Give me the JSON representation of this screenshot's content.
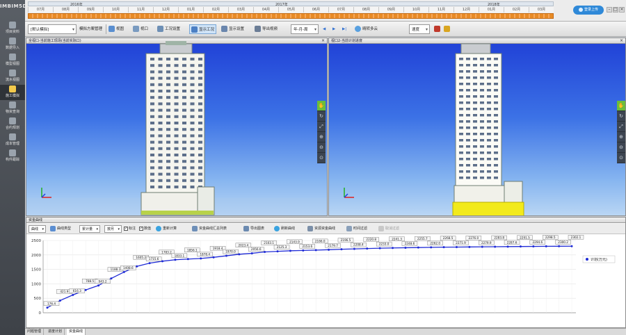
{
  "app": {
    "logo": "IMBIM5D"
  },
  "sidebar": {
    "items": [
      {
        "label": "项目资料",
        "active": false
      },
      {
        "label": "数据导入",
        "active": false
      },
      {
        "label": "模型视图",
        "active": false
      },
      {
        "label": "流水视图",
        "active": false
      },
      {
        "label": "施工模拟",
        "active": true
      },
      {
        "label": "物资查询",
        "active": false
      },
      {
        "label": "合约规划",
        "active": false
      },
      {
        "label": "成本管理",
        "active": false
      },
      {
        "label": "构件跟踪",
        "active": false
      }
    ]
  },
  "timeline": {
    "years": [
      "2016年",
      "2017年",
      "2018年"
    ],
    "months": [
      "07月",
      "08月",
      "09月",
      "10月",
      "11月",
      "12月",
      "01月",
      "02月",
      "03月",
      "04月",
      "05月",
      "06月",
      "07月",
      "08月",
      "09月",
      "10月",
      "11月",
      "12月",
      "01月",
      "02月",
      "03月"
    ],
    "online_button": "登录上传",
    "win_min": "–",
    "win_max": "□",
    "win_close": "×"
  },
  "toolbar": {
    "view_select": "[默认模拟]",
    "sim_manage": "模拟方案管理",
    "view": "视图",
    "viewport": "视口",
    "work_settings": "工况设置",
    "show_work": "显示工况",
    "display_settings": "显示设置",
    "export_video": "导出视频",
    "play_mode": "年-月-周",
    "play_prev": "◀",
    "play": "▶",
    "play_next": "▶|",
    "weather": "晴转多云",
    "speed": "速度"
  },
  "view_left": {
    "title": "全视口-当前施工现场(当前实际口)",
    "axis_x": "X",
    "axis_y": "Y"
  },
  "view_right": {
    "title": "视口2-当前计划进度",
    "axis_x": "X",
    "axis_y": "Y"
  },
  "view_tools": [
    "✋",
    "↻",
    "⤢",
    "⊕",
    "⊖",
    "⊙"
  ],
  "chart_panel": {
    "title": "资金曲线",
    "toolbar": {
      "curve_select": "曲线",
      "curve_type": "曲线类型",
      "amount_select": "累计量",
      "by_month_select": "按月",
      "chk_label": "标注",
      "chk_value": "数值",
      "recalc": "重新计算",
      "summary_list": "资金曲线汇总列表",
      "export_chart": "导出图表",
      "refresh": "刷新曲线",
      "capital_plan": "资源资金曲线",
      "time_filter": "时间过滤",
      "cancel_filter": "取消过滤"
    }
  },
  "chart_data": {
    "type": "line",
    "title": "",
    "xlabel": "",
    "ylabel": "",
    "ylim": [
      0,
      2500
    ],
    "yticks": [
      0,
      500,
      1000,
      1500,
      2000,
      2500
    ],
    "grid": true,
    "legend": "top-right",
    "series": [
      {
        "name": "计划(万元)",
        "color": "#1f2bd6",
        "values": [
          176.4,
          421.9,
          616.3,
          788.5,
          943.2,
          1188.1,
          1408.6,
          1605.2,
          1715.6,
          1783.2,
          1833.1,
          1856.1,
          1878.4,
          1918.4,
          1970.0,
          2023.4,
          2056.6,
          2103.1,
          2125.3,
          2143.9,
          2153.6,
          2166.0,
          2179.7,
          2196.5,
          2208.4,
          2220.8,
          2233.0,
          2241.3,
          2248.6,
          2255.7,
          2262.0,
          2268.5,
          2271.9,
          2276.0,
          2279.9,
          2283.8,
          2287.6,
          2291.5,
          2294.6,
          2298.5,
          2300.2,
          2302.1
        ]
      }
    ]
  },
  "bottom_tabs": [
    {
      "label": "问题管理",
      "active": false
    },
    {
      "label": "进度计划",
      "active": false
    },
    {
      "label": "资金曲线",
      "active": true
    }
  ]
}
